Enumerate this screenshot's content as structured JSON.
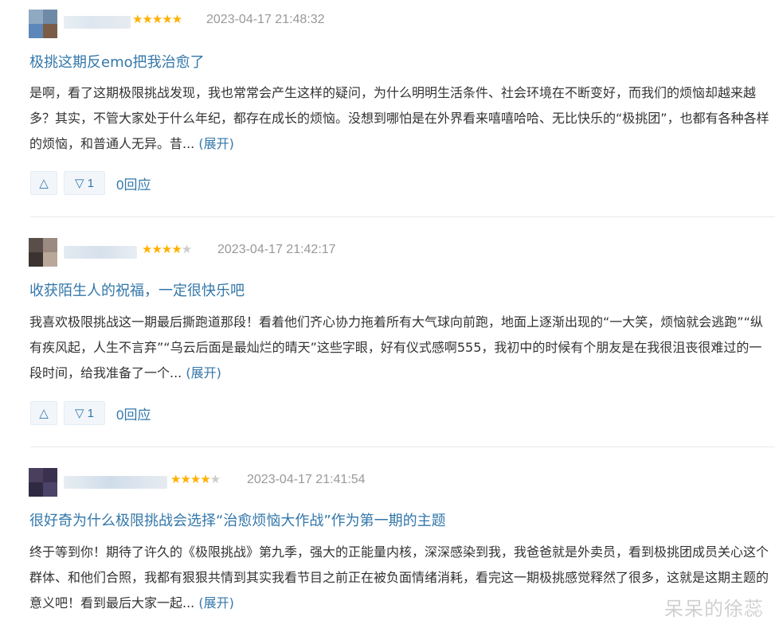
{
  "reviews": [
    {
      "stars": 5,
      "timestamp": "2023-04-17 21:48:32",
      "title": "极挑这期反emo把我治愈了",
      "body": "是啊，看了这期极限挑战发现，我也常常会产生这样的疑问，为什么明明生活条件、社会环境在不断变好，而我们的烦恼却越来越多？其实，不管大家处于什么年纪，都存在成长的烦恼。没想到哪怕是在外界看来嘻嘻哈哈、无比快乐的“极挑团”，也都有各种各样的烦恼，和普通人无异。昔...",
      "expand": "(展开)",
      "up_icon": "△",
      "down_icon": "▽",
      "down_count": "1",
      "reply": "0回应"
    },
    {
      "stars": 4,
      "timestamp": "2023-04-17 21:42:17",
      "title": "收获陌生人的祝福，一定很快乐吧",
      "body": "我喜欢极限挑战这一期最后撕跑道那段！看着他们齐心协力拖着所有大气球向前跑，地面上逐渐出现的“一大笑，烦恼就会逃跑”“纵有疾风起，人生不言弃”“乌云后面是最灿烂的晴天”这些字眼，好有仪式感啊555，我初中的时候有个朋友是在我很沮丧很难过的一段时间，给我准备了一个...",
      "expand": "(展开)",
      "up_icon": "△",
      "down_icon": "▽",
      "down_count": "1",
      "reply": "0回应"
    },
    {
      "stars": 4,
      "timestamp": "2023-04-17 21:41:54",
      "title": "很好奇为什么极限挑战会选择“治愈烦恼大作战”作为第一期的主题",
      "body": "终于等到你！期待了许久的《极限挑战》第九季，强大的正能量内核，深深感染到我，我爸爸就是外卖员，看到极挑团成员关心这个群体、和他们合照，我都有狠狠共情到其实我看节目之前正在被负面情绪消耗，看完这一期极挑感觉释然了很多，这就是这期主题的意义吧！看到最后大家一起...",
      "expand": "(展开)"
    }
  ],
  "watermark": "呆呆的徐蕊",
  "colors": {
    "link": "#3377aa",
    "star": "#ffb100",
    "muted": "#999999"
  }
}
